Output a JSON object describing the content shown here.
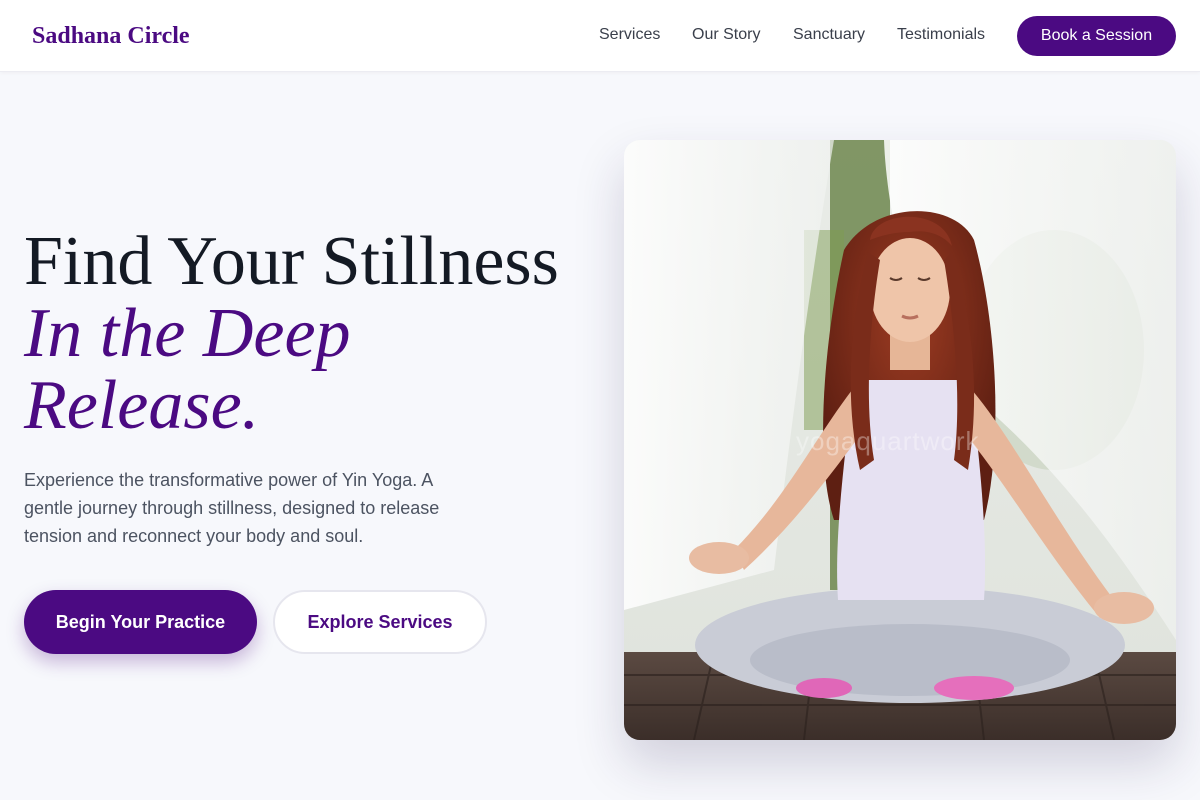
{
  "header": {
    "logo": "Sadhana Circle",
    "nav": [
      "Services",
      "Our Story",
      "Sanctuary",
      "Testimonials"
    ],
    "cta": "Book a Session"
  },
  "hero": {
    "title_line1": "Find Your Stillness",
    "title_line2": "In the Deep",
    "title_line3": "Release.",
    "lead": "Experience the transformative power of Yin Yoga. A gentle journey through stillness, designed to release tension and reconnect your body and soul.",
    "primary_button": "Begin Your Practice",
    "secondary_button": "Explore Services",
    "image_alt": "Woman meditating cross-legged on a wooden deck",
    "watermark": "yogaquartwork"
  },
  "colors": {
    "brand": "#4b0a82",
    "background": "#f7f8fc",
    "heading": "#141a24",
    "body_text": "#4c5361"
  }
}
